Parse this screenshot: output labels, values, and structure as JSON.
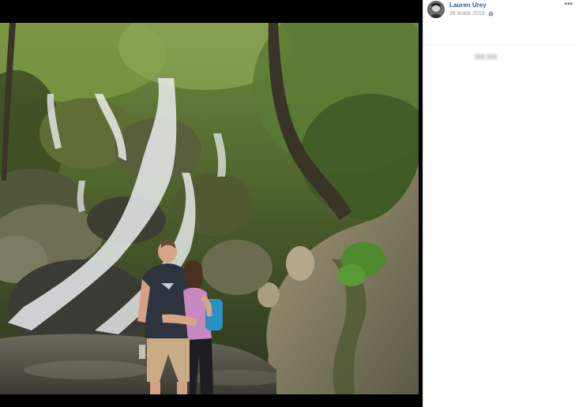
{
  "post": {
    "author": "Lauren Urey",
    "date": "26 Aralık 2018"
  },
  "icons": {
    "privacy": "globe-icon",
    "menu": "more-options-icon",
    "avatar": "profile-avatar"
  },
  "colors": {
    "author_link": "#385898",
    "meta_text": "#90949c",
    "panel_bg": "#ffffff",
    "viewer_bg": "#000000"
  }
}
